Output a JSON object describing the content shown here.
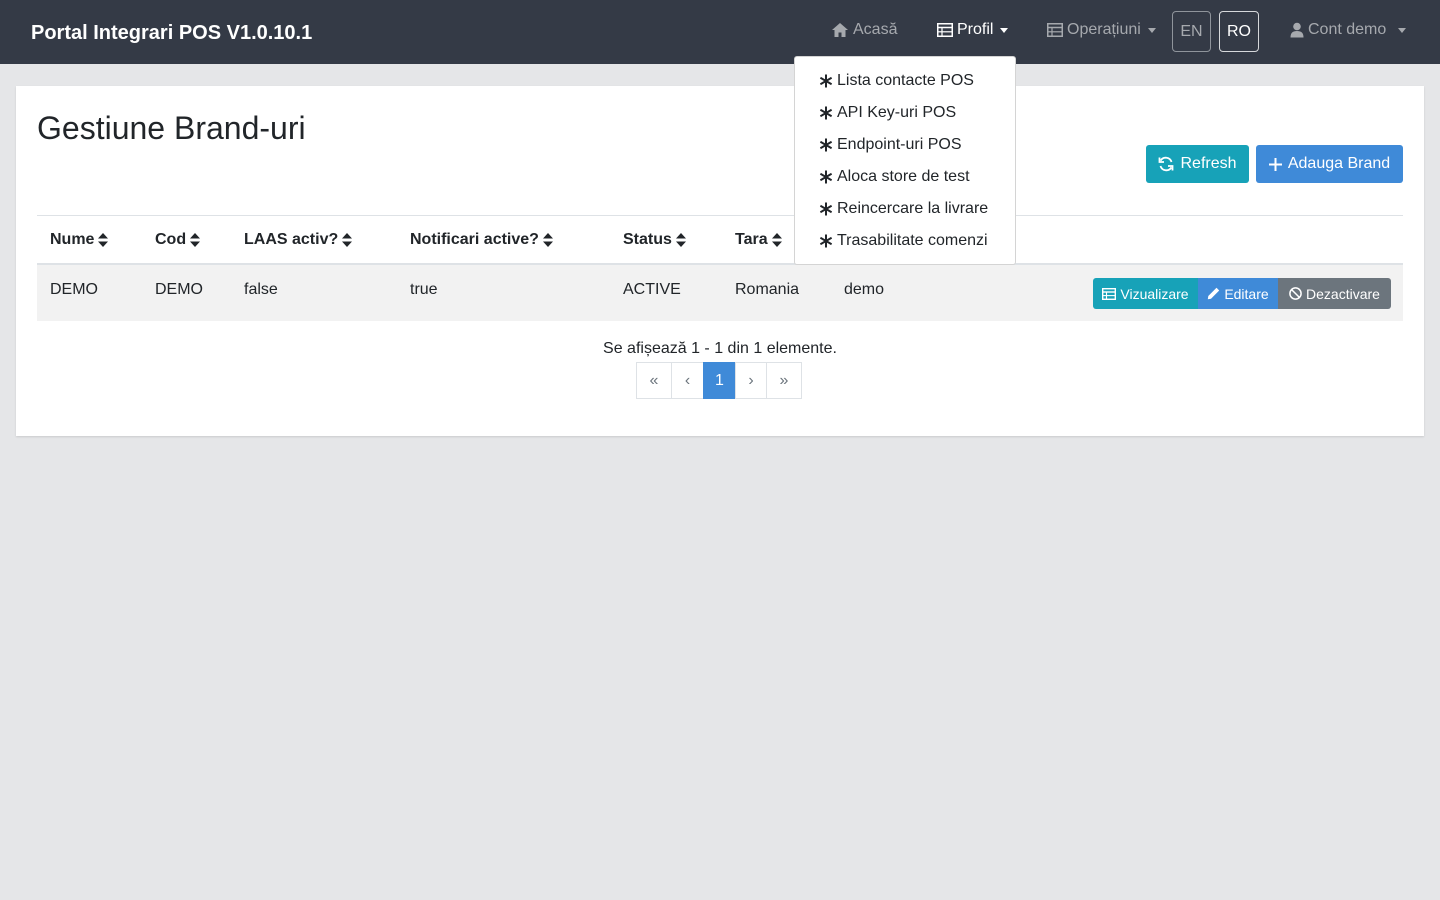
{
  "navbar": {
    "brand": "Portal Integrari POS V1.0.10.1",
    "home_label": "Acasă",
    "profile_label": "Profil",
    "operations_label": "Operațiuni",
    "lang_en": "EN",
    "lang_ro": "RO",
    "account_label": "Cont demo"
  },
  "profile_menu": {
    "items": [
      {
        "label": "Lista contacte POS"
      },
      {
        "label": "API Key-uri POS"
      },
      {
        "label": "Endpoint-uri POS"
      },
      {
        "label": "Aloca store de test"
      },
      {
        "label": "Reincercare la livrare"
      },
      {
        "label": "Trasabilitate comenzi"
      }
    ]
  },
  "page": {
    "title": "Gestiune Brand-uri",
    "refresh_label": "Refresh",
    "add_label": "Adauga Brand"
  },
  "table": {
    "columns": [
      "Nume",
      "Cod",
      "LAAS activ?",
      "Notificari active?",
      "Status",
      "Tara"
    ],
    "rows": [
      {
        "cells": [
          "DEMO",
          "DEMO",
          "false",
          "true",
          "ACTIVE",
          "Romania",
          "demo"
        ],
        "actions": {
          "view": "Vizualizare",
          "edit": "Editare",
          "deactivate": "Dezactivare"
        }
      }
    ]
  },
  "pagination": {
    "summary": "Se afișează 1 - 1 din 1 elemente.",
    "first": "«",
    "prev": "‹",
    "current": "1",
    "next": "›",
    "last": "»"
  },
  "colors": {
    "navbar": "#343a46",
    "info": "#17a2b8",
    "primary": "#3f8ad8",
    "secondary": "#6c757d",
    "background": "#e5e6e8"
  }
}
